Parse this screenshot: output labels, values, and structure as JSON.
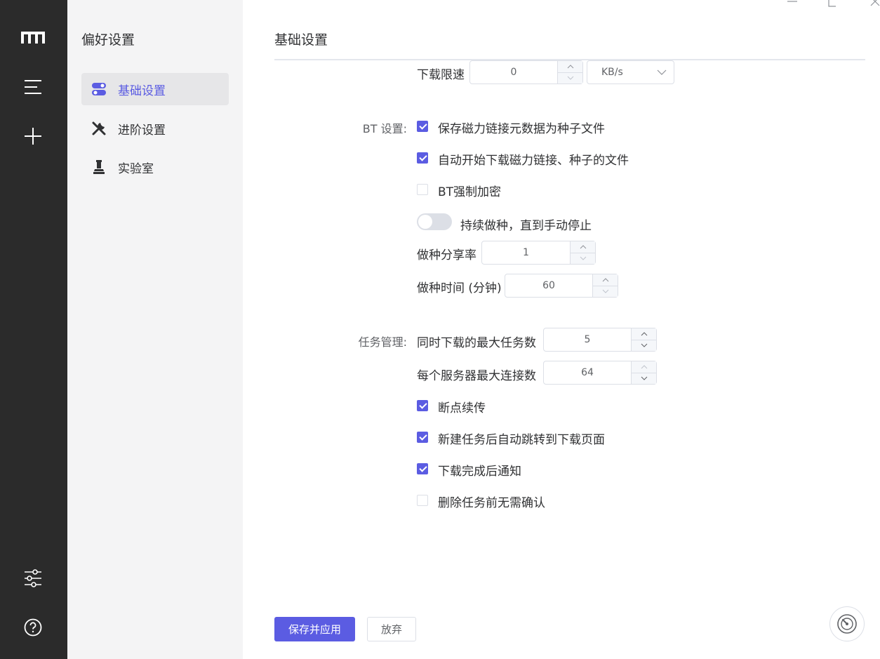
{
  "sidebar": {
    "title": "偏好设置",
    "items": [
      {
        "label": "基础设置",
        "icon": "toggle-icon",
        "active": true
      },
      {
        "label": "进阶设置",
        "icon": "tools-icon",
        "active": false
      },
      {
        "label": "实验室",
        "icon": "lab-icon",
        "active": false
      }
    ]
  },
  "rail": {
    "icons": [
      "logo-icon",
      "menu-icon",
      "add-icon",
      "settings-icon",
      "help-icon"
    ]
  },
  "main": {
    "title": "基础设置",
    "download_speed": {
      "label": "下载限速",
      "value": "0",
      "unit": "KB/s"
    },
    "bt": {
      "label": "BT 设置:",
      "save_magnet": {
        "label": "保存磁力链接元数据为种子文件",
        "checked": true
      },
      "auto_start": {
        "label": "自动开始下载磁力链接、种子的文件",
        "checked": true
      },
      "force_encrypt": {
        "label": "BT强制加密",
        "checked": false
      },
      "keep_seeding": {
        "label": "持续做种，直到手动停止",
        "on": false
      },
      "seed_ratio": {
        "label": "做种分享率",
        "value": "1"
      },
      "seed_time": {
        "label": "做种时间 (分钟)",
        "value": "60"
      }
    },
    "task": {
      "label": "任务管理:",
      "max_concurrent": {
        "label": "同时下载的最大任务数",
        "value": "5"
      },
      "max_conn": {
        "label": "每个服务器最大连接数",
        "value": "64"
      },
      "resume": {
        "label": "断点续传",
        "checked": true
      },
      "auto_jump": {
        "label": "新建任务后自动跳转到下载页面",
        "checked": true
      },
      "notify": {
        "label": "下载完成后通知",
        "checked": true
      },
      "no_confirm_delete": {
        "label": "删除任务前无需确认",
        "checked": false
      }
    },
    "save_button": "保存并应用",
    "discard_button": "放弃"
  },
  "colors": {
    "accent": "#5b5ce2",
    "rail": "#2b2b2b",
    "sidebar": "#f4f4f5"
  }
}
